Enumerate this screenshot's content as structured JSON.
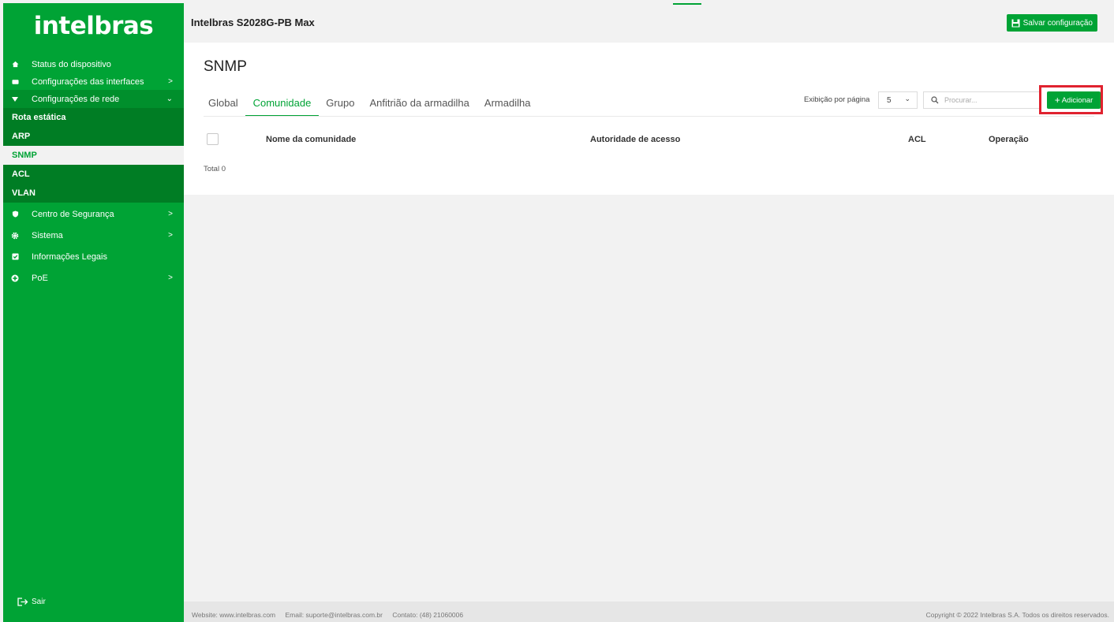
{
  "app": {
    "logo_text": "intelbras",
    "device_name": "Intelbras S2028G-PB Max",
    "save_label": "Salvar configuração"
  },
  "sidebar": {
    "items": [
      {
        "label": "Status do dispositivo",
        "icon": "home-icon",
        "chevron": ""
      },
      {
        "label": "Configurações das interfaces",
        "icon": "interface-icon",
        "chevron": ">"
      },
      {
        "label": "Configurações de rede",
        "icon": "caret-down-icon",
        "chevron": "⌄"
      },
      {
        "label": "Centro de Segurança",
        "icon": "shield-icon",
        "chevron": ">"
      },
      {
        "label": "Sistema",
        "icon": "gear-icon",
        "chevron": ">"
      },
      {
        "label": "Informações Legais",
        "icon": "checkbox-icon",
        "chevron": ""
      },
      {
        "label": "PoE",
        "icon": "plus-circle-icon",
        "chevron": ">"
      }
    ],
    "subitems": [
      "Rota estática",
      "ARP",
      "SNMP",
      "ACL",
      "VLAN"
    ],
    "active_subitem": "SNMP",
    "logout_label": "Sair"
  },
  "main": {
    "title": "SNMP",
    "tabs": [
      {
        "label": "Global",
        "active": false
      },
      {
        "label": "Comunidade",
        "active": true
      },
      {
        "label": "Grupo",
        "active": false
      },
      {
        "label": "Anfitrião da armadilha",
        "active": false
      },
      {
        "label": "Armadilha",
        "active": false
      }
    ],
    "per_page_label": "Exibição por página",
    "per_page_value": "5",
    "search_placeholder": "Procurar...",
    "add_label": "Adicionar",
    "table": {
      "columns": [
        "Nome da comunidade",
        "Autoridade de acesso",
        "ACL",
        "Operação"
      ],
      "rows": []
    },
    "total_label": "Total 0"
  },
  "footer": {
    "website": "Website: www.intelbras.com",
    "email": "Email: suporte@intelbras.com.br",
    "contact": "Contato: (48) 21060006",
    "copyright": "Copyright © 2022 Intelbras S.A. Todos os direitos reservados."
  },
  "colors": {
    "brand_green": "#00a335",
    "highlight_red": "#e0222f"
  }
}
